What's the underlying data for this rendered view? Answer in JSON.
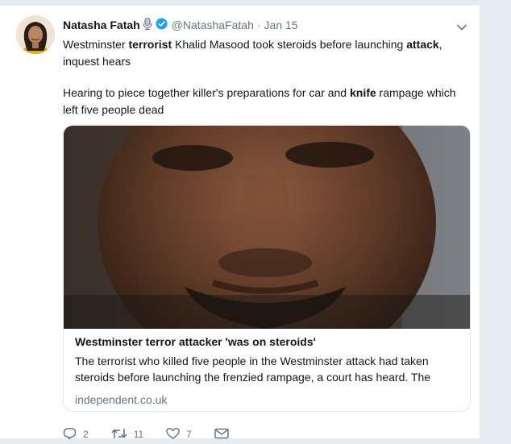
{
  "tweet": {
    "display_name": "Natasha Fatah",
    "username": "@NatashaFatah",
    "separator": "·",
    "date": "Jan 15",
    "text": {
      "line1_part1": "Westminster ",
      "line1_bold1": "terrorist",
      "line1_part2": " Khalid Masood took steroids before launching ",
      "line1_bold2": "attack",
      "line1_part3": ", inquest hears",
      "para2_part1": "Hearing to piece together killer's preparations for car and ",
      "para2_bold": "knife",
      "para2_part2": " rampage which left five people dead"
    }
  },
  "card": {
    "title": "Westminster terror attacker 'was on steroids'",
    "description": "The terrorist who killed five people in the Westminster attack had taken steroids before launching the frenzied rampage, a court has heard. The",
    "domain": "independent.co.uk"
  },
  "actions": {
    "reply_count": "2",
    "retweet_count": "11",
    "like_count": "7"
  },
  "colors": {
    "verified_blue": "#1da1f2",
    "muted_gray": "#657786",
    "background": "#e6ecf0"
  },
  "icons": [
    "microphone-icon",
    "verified-badge-icon",
    "chevron-down-icon",
    "reply-icon",
    "retweet-icon",
    "like-icon",
    "message-icon"
  ]
}
